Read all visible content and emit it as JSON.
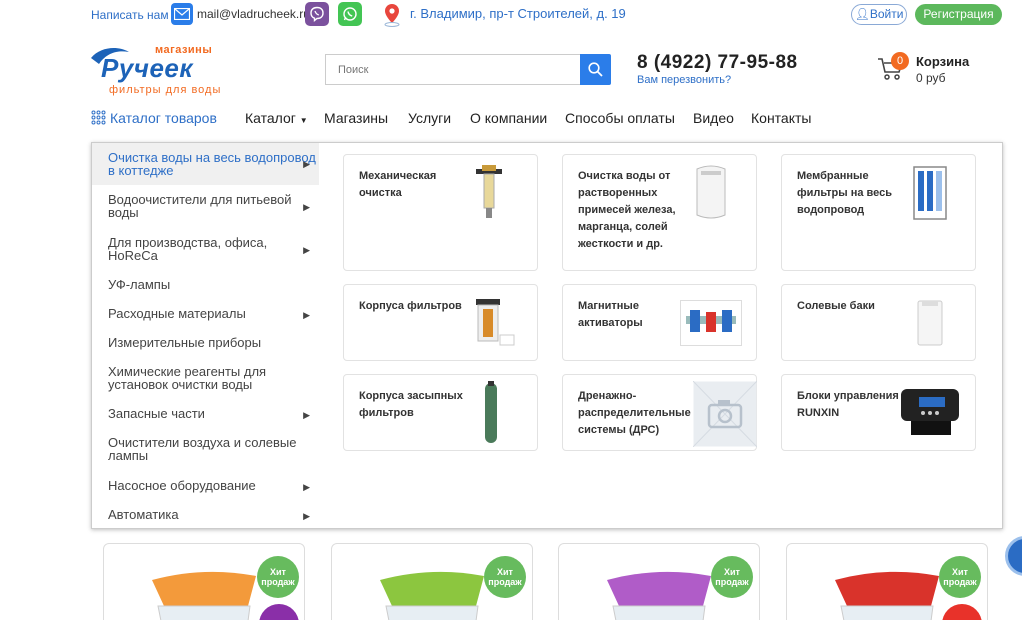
{
  "topbar": {
    "write_us": "Написать нам",
    "email": "mail@vladrucheek.ru",
    "address": "г. Владимир, пр-т Строителей, д. 19",
    "login": "Войти",
    "register": "Регистрация",
    "icons": [
      "mail-icon",
      "viber-icon",
      "whatsapp-icon",
      "map-pin-icon",
      "user-icon"
    ]
  },
  "header": {
    "logo": {
      "shops": "магазины",
      "name": "Ручеек",
      "tagline": "фильтры для воды"
    },
    "search_placeholder": "Поиск",
    "phone": "8 (4922) 77-95-88",
    "callback": "Вам перезвонить?",
    "cart": {
      "title": "Корзина",
      "sum": "0 руб",
      "count": "0"
    }
  },
  "nav": {
    "catalog_products": "Каталог товаров",
    "items": [
      "Каталог",
      "Магазины",
      "Услуги",
      "О компании",
      "Способы оплаты",
      "Видео",
      "Контакты"
    ]
  },
  "menu": {
    "items": [
      {
        "label": "Очистка воды на весь водопровод в коттедже",
        "arrow": true,
        "active": true
      },
      {
        "label": "Водоочистители для питьевой воды",
        "arrow": true
      },
      {
        "label": "Для производства, офиса, HoReCa",
        "arrow": true
      },
      {
        "label": "УФ-лампы",
        "arrow": false
      },
      {
        "label": "Расходные материалы",
        "arrow": true
      },
      {
        "label": "Измерительные приборы",
        "arrow": false
      },
      {
        "label": "Химические реагенты для установок очистки воды",
        "arrow": false
      },
      {
        "label": "Запасные части",
        "arrow": true
      },
      {
        "label": "Очистители воздуха и солевые лампы",
        "arrow": false
      },
      {
        "label": "Насосное оборудование",
        "arrow": true
      },
      {
        "label": "Автоматика",
        "arrow": true
      }
    ]
  },
  "categories": [
    {
      "label": "Механическая очистка"
    },
    {
      "label": "Очистка воды от растворенных примесей железа, марганца, солей жесткости и др."
    },
    {
      "label": "Мембранные фильтры на весь водопровод"
    },
    {
      "label": "Корпуса фильтров"
    },
    {
      "label": "Магнитные активаторы"
    },
    {
      "label": "Солевые баки"
    },
    {
      "label": "Корпуса засыпных фильтров"
    },
    {
      "label": "Дренажно-распределительные системы (ДРС)"
    },
    {
      "label": "Блоки управления RUNXIN"
    }
  ],
  "products": [
    {
      "badge": "Хит продаж",
      "color": "#f39a3b"
    },
    {
      "badge": "Хит продаж",
      "color": "#8cc63f"
    },
    {
      "badge": "Хит продаж",
      "color": "#b05cc8"
    },
    {
      "badge": "Хит продаж",
      "color": "#d9332b"
    }
  ],
  "colors": {
    "accent": "#2b7de9",
    "brand_orange": "#f26a21",
    "green": "#5cb85c"
  }
}
